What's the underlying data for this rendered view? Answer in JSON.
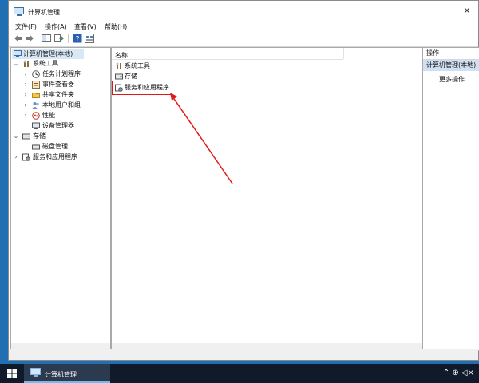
{
  "window": {
    "title": "计算机管理",
    "close_glyph": "✕"
  },
  "menu": [
    "文件(F)",
    "操作(A)",
    "查看(V)",
    "帮助(H)"
  ],
  "toolbar": {
    "icons": [
      "back-arrow-icon",
      "forward-arrow-icon",
      "show-hide-tree-icon",
      "export-list-icon",
      "help-icon",
      "properties-icon"
    ]
  },
  "tree": {
    "root": "计算机管理(本地)",
    "system_tools": "系统工具",
    "children": [
      "任务计划程序",
      "事件查看器",
      "共享文件夹",
      "本地用户和组",
      "性能",
      "设备管理器"
    ],
    "storage": "存储",
    "disk_mgmt": "磁盘管理",
    "services_apps": "服务和应用程序"
  },
  "list": {
    "header": "名称",
    "items": [
      "系统工具",
      "存储",
      "服务和应用程序"
    ]
  },
  "actions": {
    "title": "操作",
    "subtitle": "计算机管理(本地)",
    "more": "更多操作"
  },
  "taskbar": {
    "app_label": "计算机管理",
    "tray_glyphs": "⌃  ⊕  ◁×"
  },
  "colors": {
    "highlight_red": "#e01818",
    "desktop_blue": "#1f6fb2",
    "taskbar": "#0f1a2a"
  }
}
